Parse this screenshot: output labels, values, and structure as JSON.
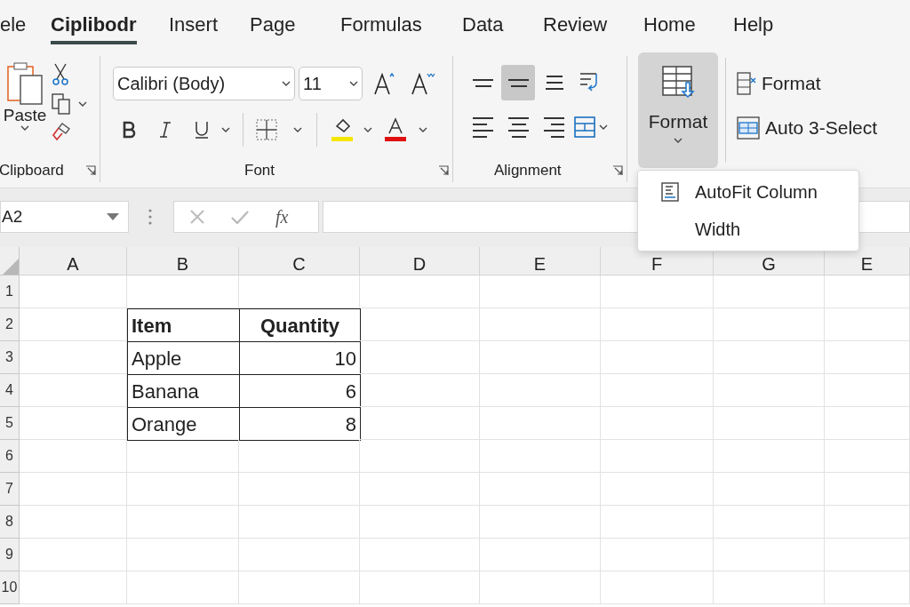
{
  "tabs": [
    {
      "label": "ele",
      "selected": false
    },
    {
      "label": "Ciplibodr",
      "selected": true
    },
    {
      "label": "Insert",
      "selected": false
    },
    {
      "label": "Page",
      "selected": false
    },
    {
      "label": "Formulas",
      "selected": false
    },
    {
      "label": "Data",
      "selected": false
    },
    {
      "label": "Review",
      "selected": false
    },
    {
      "label": "Home",
      "selected": false
    },
    {
      "label": "Help",
      "selected": false
    }
  ],
  "ribbon": {
    "clipboard": {
      "paste_label": "Paste",
      "group_label": "Clipboard"
    },
    "font": {
      "font_name": "Calibri (Body)",
      "font_size": "11",
      "group_label": "Font"
    },
    "alignment": {
      "group_label": "Alignment",
      "buttons": [
        {
          "kind": "top",
          "selected": false
        },
        {
          "kind": "middle",
          "selected": true
        },
        {
          "kind": "bottom",
          "selected": false
        },
        {
          "kind": "wrap",
          "selected": false
        },
        {
          "kind": "left",
          "selected": false
        },
        {
          "kind": "center",
          "selected": false
        },
        {
          "kind": "right",
          "selected": false
        },
        {
          "kind": "merge",
          "selected": false
        }
      ]
    },
    "format_button": {
      "label": "Format",
      "pressed": true
    },
    "side_buttons": [
      {
        "kind": "format",
        "label": "Format"
      },
      {
        "kind": "select",
        "label": "Auto 3-Select"
      }
    ]
  },
  "dropdown_menu": {
    "items": [
      {
        "label": "AutoFit Column",
        "icon": true
      },
      {
        "label": "Width",
        "icon": false
      }
    ]
  },
  "formula_bar": {
    "name_box": "A2",
    "fx": "fx"
  },
  "sheet": {
    "columns": [
      "A",
      "B",
      "C",
      "D",
      "E",
      "F",
      "G",
      "E"
    ],
    "rows": [
      "1",
      "2",
      "3",
      "4",
      "5",
      "6",
      "7",
      "8",
      "9",
      "10"
    ],
    "table": {
      "header": [
        "Item",
        "Quantity"
      ],
      "rows": [
        [
          "Apple",
          "10"
        ],
        [
          "Banana",
          "6"
        ],
        [
          "Orange",
          "8"
        ]
      ]
    }
  }
}
